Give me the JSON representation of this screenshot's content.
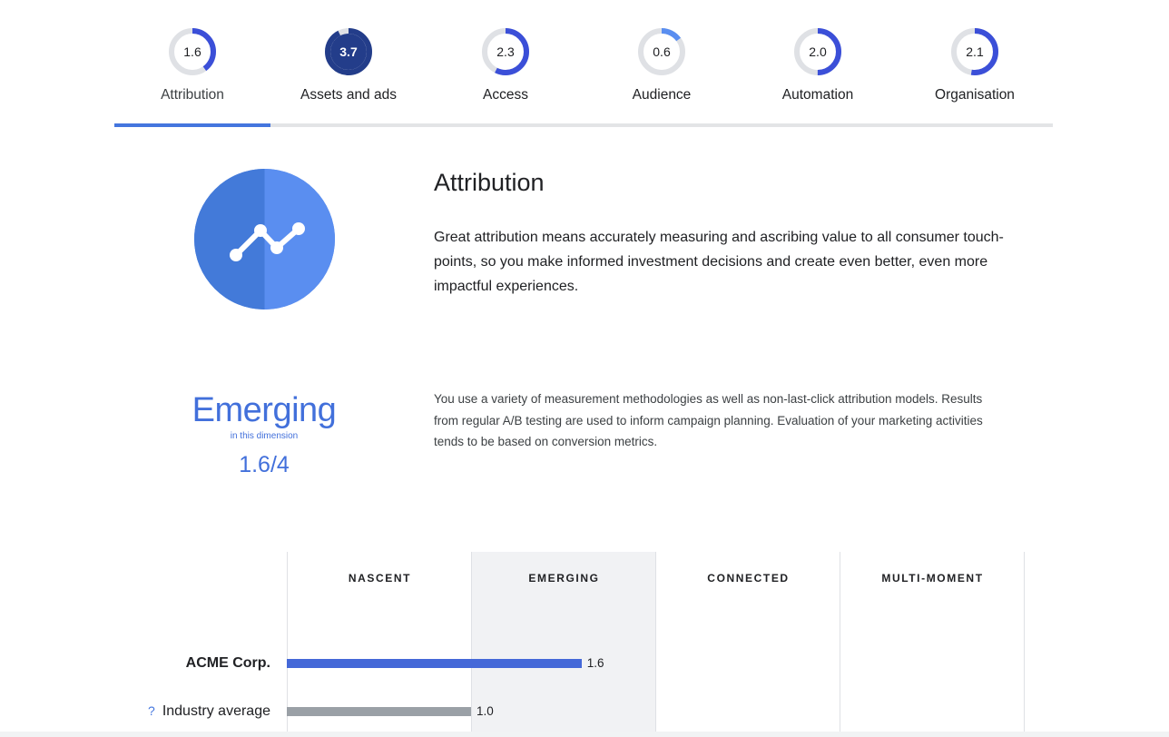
{
  "tabs": [
    {
      "label": "Attribution",
      "score": "1.6",
      "value": 1.6,
      "active": true
    },
    {
      "label": "Assets and ads",
      "score": "3.7",
      "value": 3.7,
      "active": false
    },
    {
      "label": "Access",
      "score": "2.3",
      "value": 2.3,
      "active": false
    },
    {
      "label": "Audience",
      "score": "0.6",
      "value": 0.6,
      "active": false
    },
    {
      "label": "Automation",
      "score": "2.0",
      "value": 2.0,
      "active": false
    },
    {
      "label": "Organisation",
      "score": "2.1",
      "value": 2.1,
      "active": false
    }
  ],
  "score_max": 4,
  "colors": {
    "ring_track": "#dfe1e5",
    "ring_light": "#5a8ef0",
    "ring_mid": "#3b4fd8",
    "ring_dark": "#233d8a",
    "accent": "#4476de",
    "stage_text": "#4270db",
    "bar_company": "#4468d8",
    "bar_industry": "#9aa0a6",
    "highlight_column": "#f1f2f4"
  },
  "section": {
    "icon": "trend-line-icon",
    "title": "Attribution",
    "description": "Great attribution means accurately measuring and ascribing value to all consumer touch-points, so you make informed investment decisions and create even better, even more impactful experiences."
  },
  "maturity": {
    "stage": "Emerging",
    "sub": "in this dimension",
    "score": "1.6/4",
    "description": "You use a variety of measurement methodologies as well as non-last-click attribution models. Results from regular A/B testing are used to inform campaign planning. Evaluation of your marketing activities tends to be based on conversion metrics."
  },
  "benchmark": {
    "stages": [
      "NASCENT",
      "EMERGING",
      "CONNECTED",
      "MULTI-MOMENT"
    ],
    "highlighted_stage": "EMERGING",
    "rows": [
      {
        "label": "ACME Corp.",
        "value": 1.6,
        "value_label": "1.6",
        "help": false
      },
      {
        "label": "Industry average",
        "value": 1.0,
        "value_label": "1.0",
        "help": true,
        "help_icon": "question-icon",
        "help_glyph": "?"
      }
    ]
  }
}
